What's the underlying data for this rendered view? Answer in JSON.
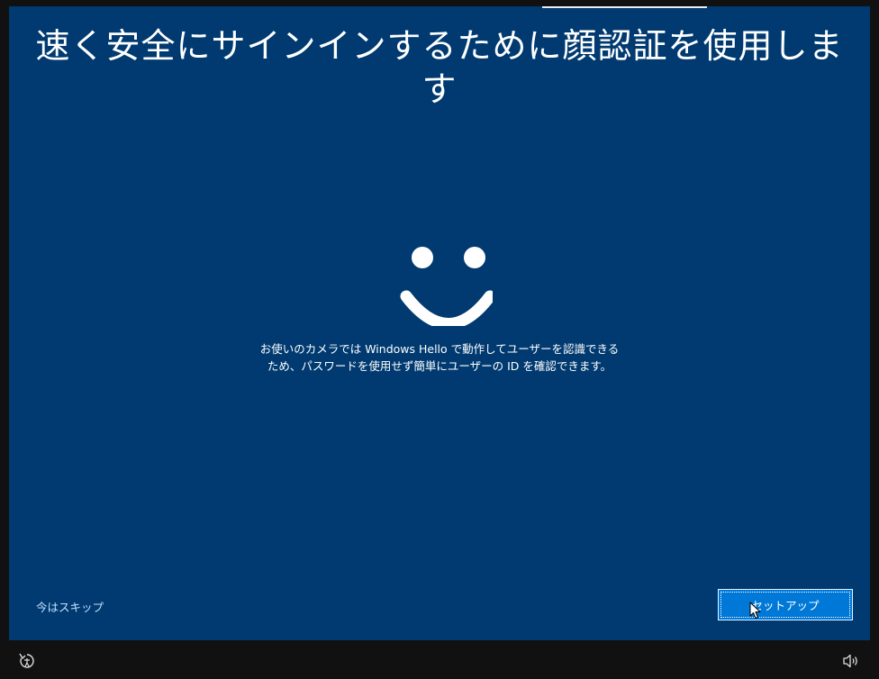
{
  "oobe": {
    "heading": "速く安全にサインインするために顔認証を使用します",
    "description_line1": "お使いのカメラでは Windows Hello で動作してユーザーを認識できる",
    "description_line2": "ため、パスワードを使用せず簡単にユーザーの ID を確認できます。",
    "skip_label": "今はスキップ",
    "setup_label": "セットアップ",
    "hello_icon": "smiley-face-icon"
  },
  "taskbar": {
    "accessibility_icon": "ease-of-access-icon",
    "volume_icon": "speaker-volume-icon"
  },
  "colors": {
    "background": "#003a70",
    "frame": "#111111",
    "primary_button": "#0078d7",
    "link": "#bfe0ff",
    "text": "#ffffff"
  }
}
